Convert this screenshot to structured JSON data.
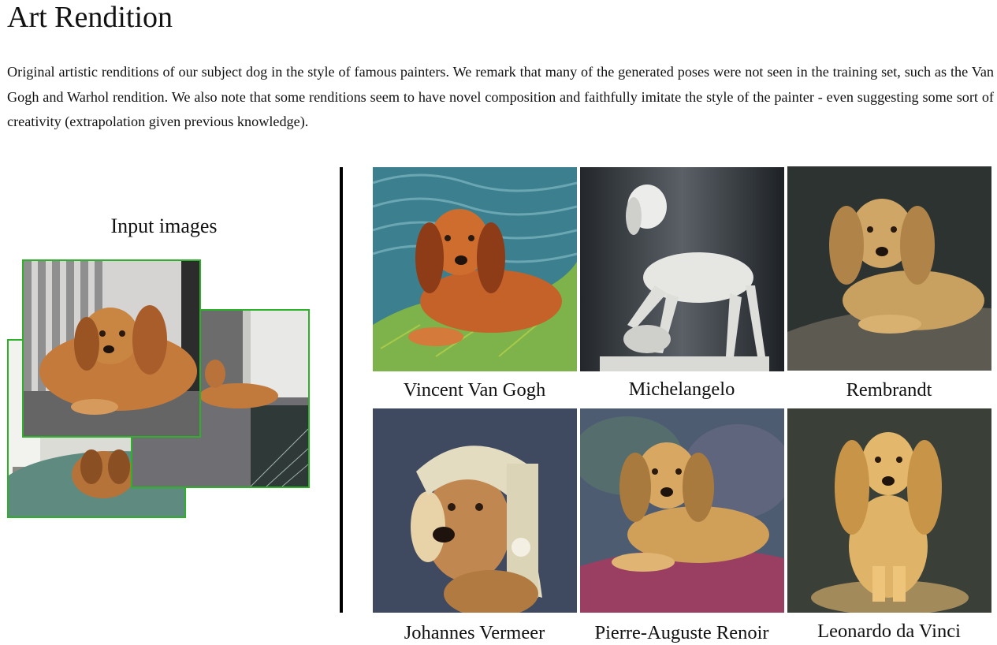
{
  "header": {
    "title": "Art Rendition"
  },
  "description": "Original artistic renditions of our subject dog in the style of famous painters. We remark that many of the generated poses were not seen in the training set, such as the Van Gogh and Warhol rendition. We also note that some renditions seem to have novel composition and faithfully imitate the style of the painter - even suggesting some sort of creativity (extrapolation given previous knowledge).",
  "input_section": {
    "title": "Input images",
    "border_color": "#2fb02a"
  },
  "renditions": [
    {
      "caption": "Vincent Van Gogh"
    },
    {
      "caption": "Michelangelo"
    },
    {
      "caption": "Rembrandt"
    },
    {
      "caption": "Johannes Vermeer"
    },
    {
      "caption": "Pierre-Auguste Renoir"
    },
    {
      "caption": "Leonardo da Vinci"
    }
  ]
}
